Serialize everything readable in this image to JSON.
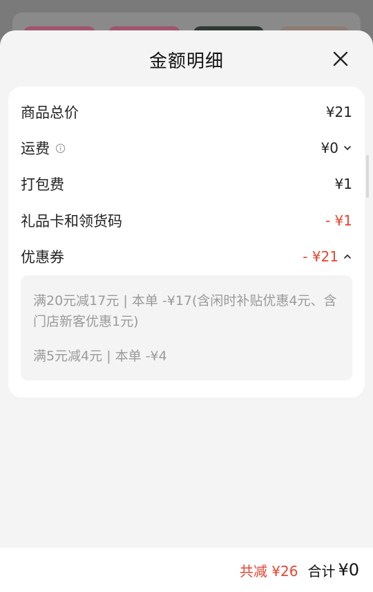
{
  "sheet": {
    "title": "金额明细",
    "close_icon": "close-icon"
  },
  "rows": [
    {
      "label": "商品总价",
      "value": "¥21"
    },
    {
      "label": "运费",
      "value": "¥0",
      "icon": "info-icon",
      "chevron": "chevron-down-icon"
    },
    {
      "label": "打包费",
      "value": "¥1"
    },
    {
      "label": "礼品卡和领货码",
      "value": "- ¥1",
      "value_color": "#e8432e"
    },
    {
      "label": "优惠券",
      "value": "- ¥21",
      "value_color": "#e8432e",
      "chevron": "chevron-up-icon"
    }
  ],
  "coupons": [
    {
      "text": "满20元减17元 | 本单 -¥17(含闲时补贴优惠4元、含门店新客优惠1元)"
    },
    {
      "text": "满5元减4元 | 本单 -¥4"
    }
  ],
  "footer": {
    "saved": "共减 ¥26",
    "total_label": "合计",
    "total_value": "¥0"
  },
  "colors": {
    "accent_red": "#e8432e"
  }
}
